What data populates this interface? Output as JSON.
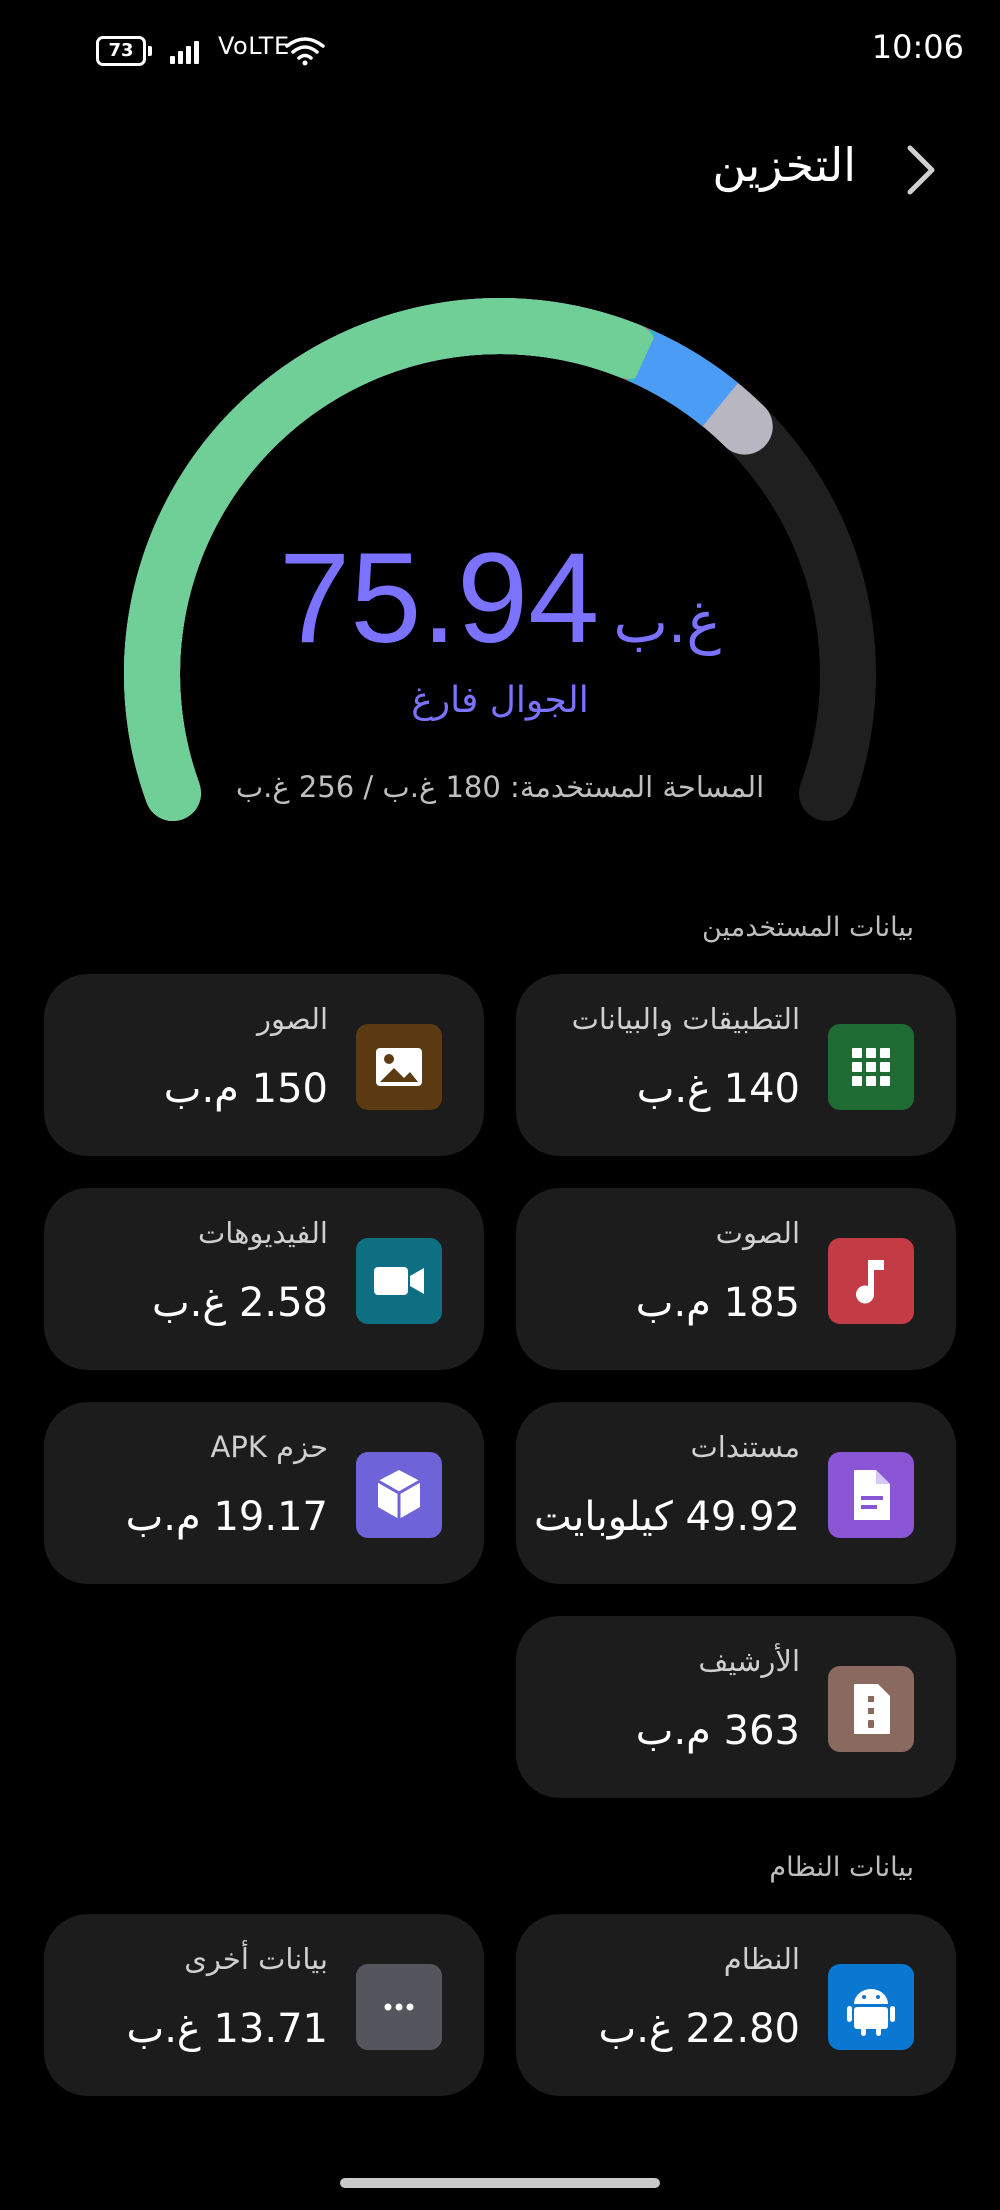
{
  "status_bar": {
    "battery": "73",
    "network": "VoLTE",
    "time": "10:06"
  },
  "header": {
    "title": "التخزين"
  },
  "gauge": {
    "free_value": "75.94",
    "free_unit": "غ.ب",
    "free_label": "الجوال فارغ",
    "used_text": "المساحة المستخدمة: 180 غ.ب / 256 غ.ب",
    "used_gb": 180,
    "total_gb": 256,
    "colors": {
      "apps": "#6fcf97",
      "docs": "#9b7ef0",
      "audio": "#e0505a",
      "videos": "#3bb0c9",
      "system": "#4a9cf5",
      "other": "#b8b6c0",
      "track": "#1f1f1f"
    }
  },
  "user_data": {
    "title": "بيانات المستخدمين",
    "cards": [
      {
        "label": "التطبيقات والبيانات",
        "value": "140 غ.ب",
        "icon": "apps-grid-icon",
        "color": "#1e6b34"
      },
      {
        "label": "الصور",
        "value": "150 م.ب",
        "icon": "image-icon",
        "color": "#5c3a12"
      },
      {
        "label": "الصوت",
        "value": "185 م.ب",
        "icon": "music-note-icon",
        "color": "#c23b45"
      },
      {
        "label": "الفيديوهات",
        "value": "2.58 غ.ب",
        "icon": "video-camera-icon",
        "color": "#0f6f82"
      },
      {
        "label": "مستندات",
        "value": "49.92 كيلوبايت",
        "icon": "document-icon",
        "color": "#8a56d6"
      },
      {
        "label": "حزم APK",
        "value": "19.17 م.ب",
        "icon": "package-cube-icon",
        "color": "#6e63d9"
      },
      {
        "label": "الأرشيف",
        "value": "363 م.ب",
        "icon": "archive-file-icon",
        "color": "#8a6a5e"
      }
    ]
  },
  "system_data": {
    "title": "بيانات النظام",
    "cards": [
      {
        "label": "النظام",
        "value": "22.80 غ.ب",
        "icon": "android-icon",
        "color": "#0a78d0"
      },
      {
        "label": "بيانات أخرى",
        "value": "13.71 غ.ب",
        "icon": "more-dots-icon",
        "color": "#55555e"
      }
    ]
  }
}
